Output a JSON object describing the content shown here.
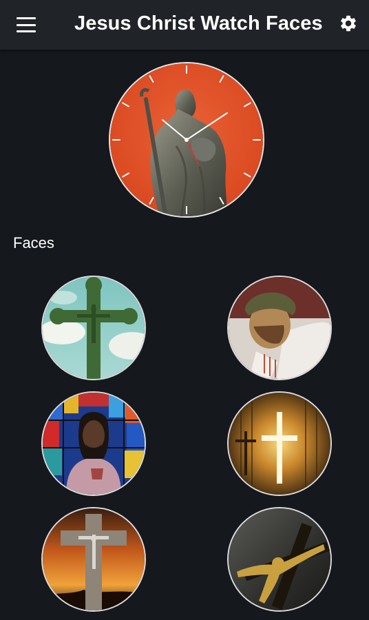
{
  "app_bar": {
    "title": "Jesus Christ Watch Faces",
    "menu_icon": "hamburger-menu-icon",
    "settings_icon": "gear-icon"
  },
  "preview": {
    "name": "selected-watch-face-preview",
    "background_color": "#e2542c",
    "hand_color": "#ffffff",
    "second_hand_color": "#e03030"
  },
  "faces_section": {
    "label": "Faces",
    "items": [
      {
        "id": "face-1",
        "depicts": "green cross with crucifix, sky background"
      },
      {
        "id": "face-2",
        "depicts": "Jesus with crown of thorns"
      },
      {
        "id": "face-3",
        "depicts": "Jesus in front of stained glass"
      },
      {
        "id": "face-4",
        "depicts": "glowing cross on golden background"
      },
      {
        "id": "face-5",
        "depicts": "stone crucifix at sunset"
      },
      {
        "id": "face-6",
        "depicts": "golden crucifix against dark sky"
      }
    ]
  }
}
